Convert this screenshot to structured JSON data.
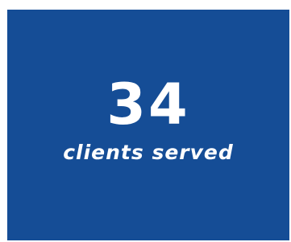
{
  "stat": {
    "value": "34",
    "caption": "clients served"
  },
  "colors": {
    "card_background": "#154d96",
    "text": "#ffffff",
    "page_background": "#ffffff"
  }
}
